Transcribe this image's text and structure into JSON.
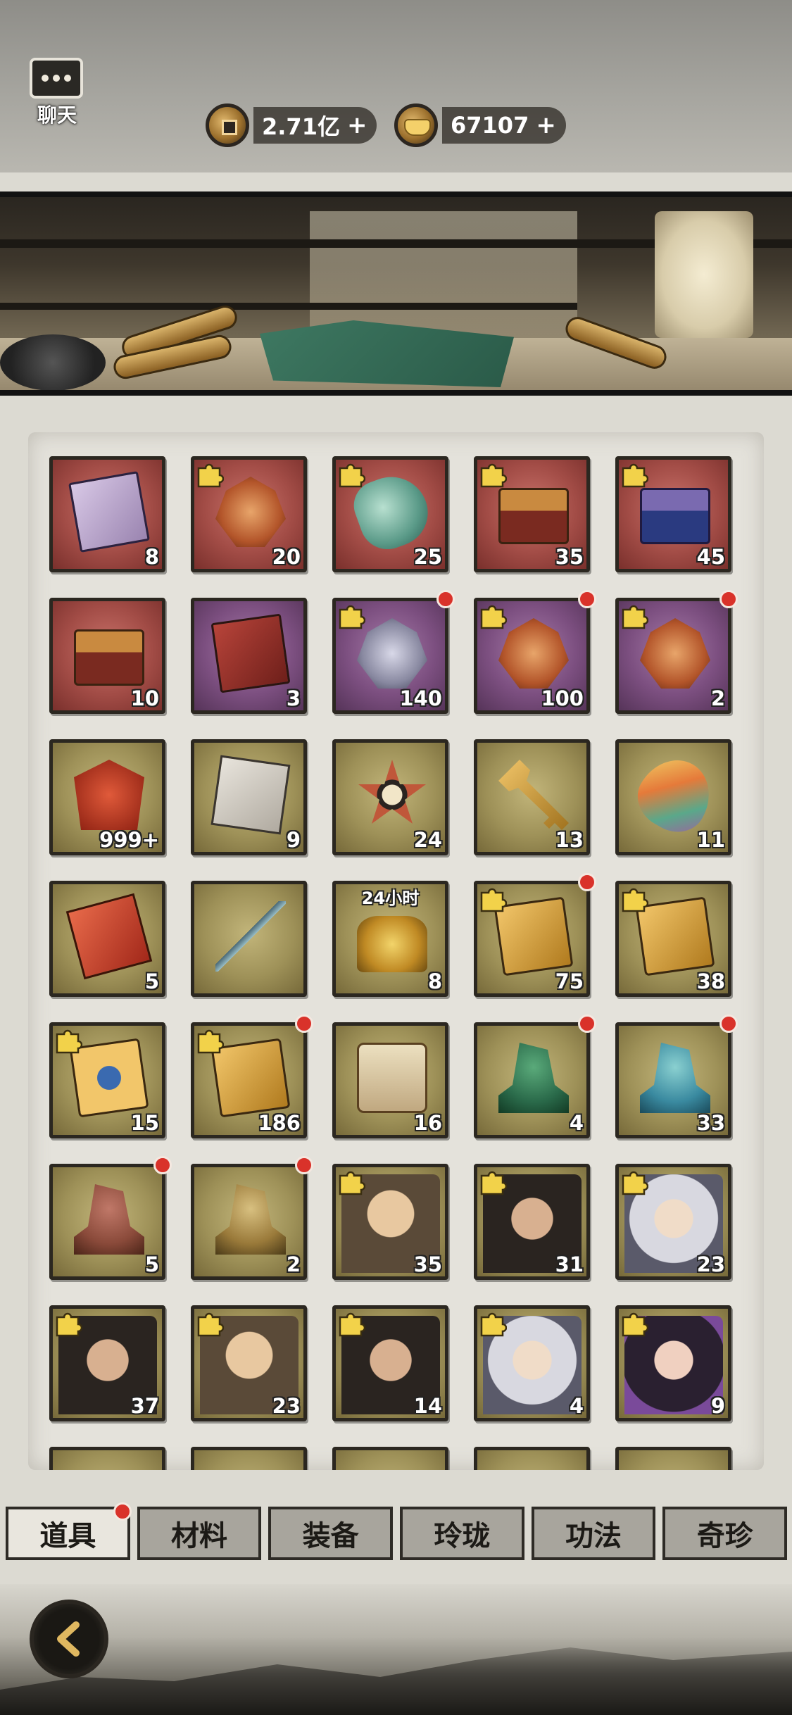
{
  "header": {
    "chat_label": "聊天",
    "currencies": [
      {
        "icon": "copper-coin-icon",
        "value": "2.71亿"
      },
      {
        "icon": "gold-ingot-icon",
        "value": "67107"
      }
    ],
    "plus_symbol": "+"
  },
  "items": [
    {
      "bg": "red",
      "art": "book",
      "count": "8",
      "puzzle": false,
      "dot": false
    },
    {
      "bg": "red",
      "art": "token",
      "count": "20",
      "puzzle": true,
      "dot": false
    },
    {
      "bg": "red",
      "art": "jade",
      "count": "25",
      "puzzle": true,
      "dot": false
    },
    {
      "bg": "red",
      "art": "chest",
      "count": "35",
      "puzzle": true,
      "dot": false
    },
    {
      "bg": "red",
      "art": "chest-blue",
      "count": "45",
      "puzzle": true,
      "dot": false
    },
    {
      "bg": "red",
      "art": "chest",
      "count": "10",
      "puzzle": false,
      "dot": false
    },
    {
      "bg": "purple",
      "art": "book-red",
      "count": "3",
      "puzzle": false,
      "dot": false
    },
    {
      "bg": "purple",
      "art": "token-silver",
      "count": "140",
      "puzzle": true,
      "dot": true
    },
    {
      "bg": "purple",
      "art": "token",
      "count": "100",
      "puzzle": true,
      "dot": true
    },
    {
      "bg": "purple",
      "art": "token",
      "count": "2",
      "puzzle": true,
      "dot": true
    },
    {
      "bg": "olive",
      "art": "mask",
      "count": "999+",
      "puzzle": false,
      "dot": false
    },
    {
      "bg": "olive",
      "art": "paper",
      "count": "9",
      "puzzle": false,
      "dot": false
    },
    {
      "bg": "olive",
      "art": "star",
      "count": "24",
      "puzzle": false,
      "dot": false
    },
    {
      "bg": "olive",
      "art": "key",
      "count": "13",
      "puzzle": false,
      "dot": false
    },
    {
      "bg": "olive",
      "art": "gem",
      "count": "11",
      "puzzle": false,
      "dot": false
    },
    {
      "bg": "olive",
      "art": "redbook",
      "count": "5",
      "puzzle": false,
      "dot": false
    },
    {
      "bg": "olive",
      "art": "sword",
      "count": "",
      "puzzle": false,
      "dot": false
    },
    {
      "bg": "olive",
      "art": "gold",
      "count": "8",
      "puzzle": false,
      "dot": false,
      "timer": "24小时"
    },
    {
      "bg": "olive",
      "art": "card",
      "count": "75",
      "puzzle": true,
      "dot": true
    },
    {
      "bg": "olive",
      "art": "card",
      "count": "38",
      "puzzle": true,
      "dot": false
    },
    {
      "bg": "olive",
      "art": "card-blue",
      "count": "15",
      "puzzle": true,
      "dot": false
    },
    {
      "bg": "olive",
      "art": "card",
      "count": "186",
      "puzzle": true,
      "dot": true
    },
    {
      "bg": "olive",
      "art": "map",
      "count": "16",
      "puzzle": false,
      "dot": false
    },
    {
      "bg": "olive",
      "art": "dragon",
      "count": "4",
      "puzzle": false,
      "dot": true
    },
    {
      "bg": "olive",
      "art": "dragon-blue",
      "count": "33",
      "puzzle": false,
      "dot": true
    },
    {
      "bg": "olive",
      "art": "dragon-red",
      "count": "5",
      "puzzle": false,
      "dot": true
    },
    {
      "bg": "olive",
      "art": "dragon-gold",
      "count": "2",
      "puzzle": false,
      "dot": true
    },
    {
      "bg": "olive",
      "art": "face",
      "count": "35",
      "puzzle": true,
      "dot": false
    },
    {
      "bg": "olive",
      "art": "face-dark",
      "count": "31",
      "puzzle": true,
      "dot": false
    },
    {
      "bg": "olive",
      "art": "face-white",
      "count": "23",
      "puzzle": true,
      "dot": false
    },
    {
      "bg": "olive",
      "art": "face-dark",
      "count": "37",
      "puzzle": true,
      "dot": false
    },
    {
      "bg": "olive",
      "art": "face",
      "count": "23",
      "puzzle": true,
      "dot": false
    },
    {
      "bg": "olive",
      "art": "face-dark",
      "count": "14",
      "puzzle": true,
      "dot": false
    },
    {
      "bg": "olive",
      "art": "face-white",
      "count": "4",
      "puzzle": true,
      "dot": false
    },
    {
      "bg": "olive",
      "art": "face-purple",
      "count": "9",
      "puzzle": true,
      "dot": false
    }
  ],
  "tabs": [
    {
      "label": "道具",
      "active": true,
      "dot": true
    },
    {
      "label": "材料",
      "active": false,
      "dot": false
    },
    {
      "label": "装备",
      "active": false,
      "dot": false
    },
    {
      "label": "玲珑",
      "active": false,
      "dot": false
    },
    {
      "label": "功法",
      "active": false,
      "dot": false
    },
    {
      "label": "奇珍",
      "active": false,
      "dot": false
    }
  ],
  "colors": {
    "red_dot": "#d9322a",
    "puzzle_gold": "#f2d24a"
  }
}
